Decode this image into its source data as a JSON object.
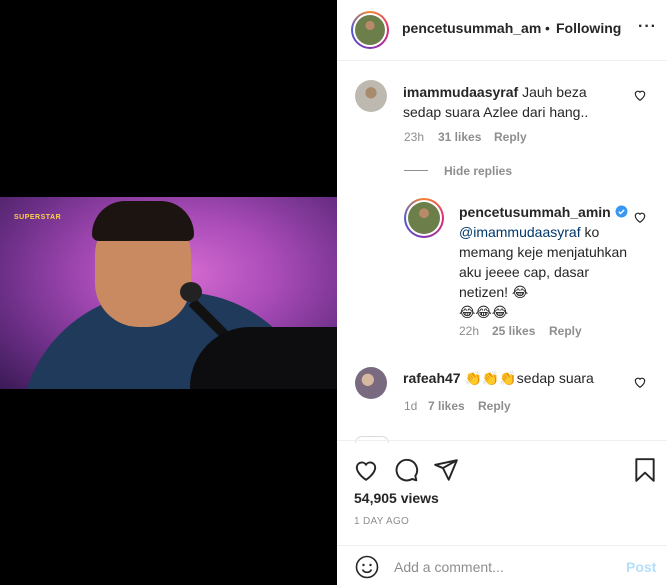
{
  "post": {
    "author": "pencetusummah_ami",
    "separator": "•",
    "follow_status": "Following",
    "more_glyph": "···"
  },
  "media": {
    "logo_text": "SUPERSTAR"
  },
  "comments": [
    {
      "username": "imammudaasyraf",
      "text": "Jauh beza sedap suara Azlee dari hang..",
      "time": "23h",
      "likes": "31 likes",
      "reply_label": "Reply"
    },
    {
      "username": "rafeah47",
      "text": "👏👏👏sedap suara",
      "time": "1d",
      "likes": "7 likes",
      "reply_label": "Reply"
    }
  ],
  "hide_replies_label": "Hide replies",
  "reply": {
    "username": "pencetusummah_amin",
    "mention": "@imammudaasyraf",
    "text": " ko memang keje menjatuhkan aku jeeee cap, dasar netizen! 😂",
    "emojis": "😂😂😂",
    "time": "22h",
    "likes": "25 likes",
    "reply_label": "Reply",
    "verified_color": "#3897f0"
  },
  "stats": {
    "views": "54,905 views",
    "posted": "1 DAY AGO"
  },
  "composer": {
    "placeholder": "Add a comment...",
    "post_label": "Post"
  },
  "colors": {
    "post_disabled": "#b2dffc",
    "link": "#00376b"
  },
  "icons": [
    "heart-icon",
    "comment-icon",
    "share-icon",
    "bookmark-icon",
    "emoji-icon",
    "more-icon",
    "verified-icon"
  ]
}
